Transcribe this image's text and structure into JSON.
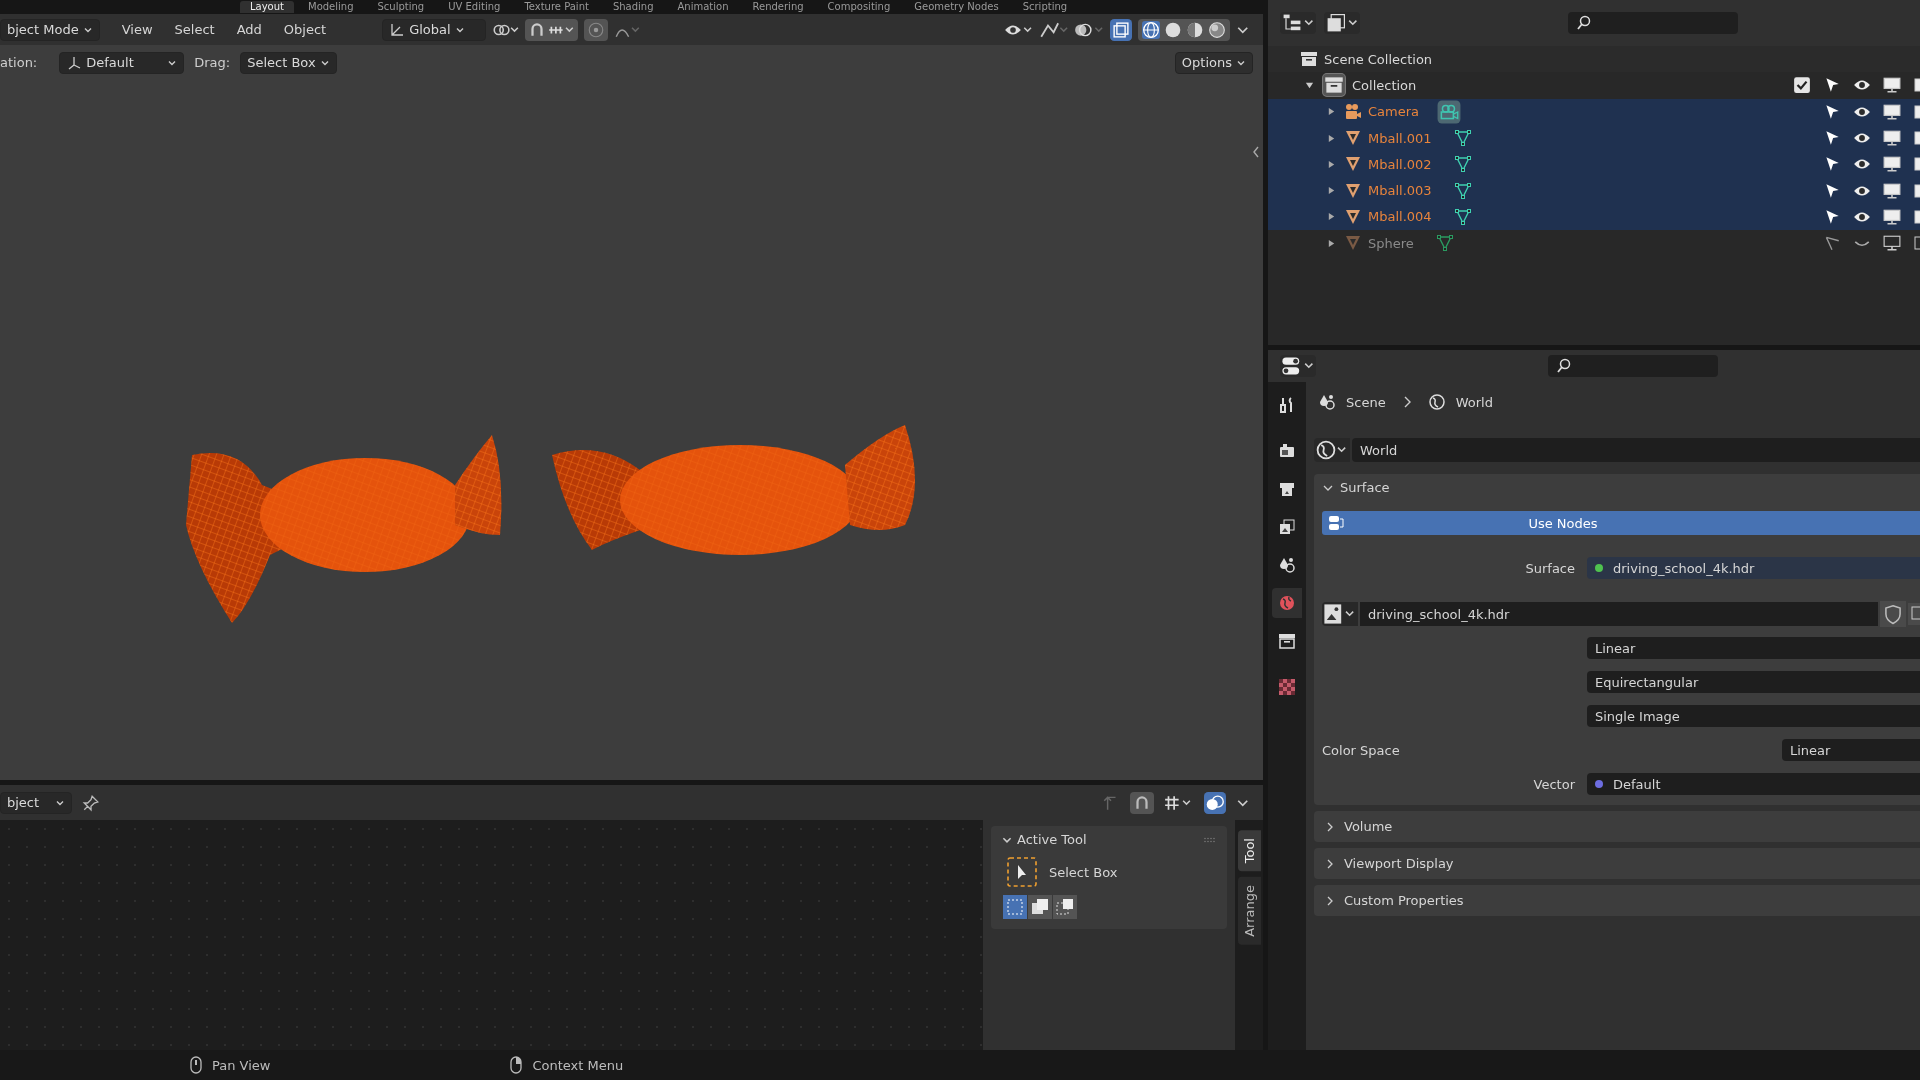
{
  "workspace_tabs": [
    {
      "label": "Layout",
      "selected": true
    },
    {
      "label": "Modeling",
      "selected": false
    },
    {
      "label": "Sculpting",
      "selected": false
    },
    {
      "label": "UV Editing",
      "selected": false
    },
    {
      "label": "Texture Paint",
      "selected": false
    },
    {
      "label": "Shading",
      "selected": false
    },
    {
      "label": "Animation",
      "selected": false
    },
    {
      "label": "Rendering",
      "selected": false
    },
    {
      "label": "Compositing",
      "selected": false
    },
    {
      "label": "Geometry Nodes",
      "selected": false
    },
    {
      "label": "Scripting",
      "selected": false
    }
  ],
  "viewport_header": {
    "mode": "bject Mode",
    "menus": [
      "View",
      "Select",
      "Add",
      "Object"
    ],
    "orientation": "Global"
  },
  "tool_settings": {
    "orientation_label": "ation:",
    "orientation": "Default",
    "drag_label": "Drag:",
    "drag": "Select Box",
    "options": "Options"
  },
  "outliner": {
    "items": [
      {
        "name": "Scene Collection",
        "kind": "scene_collection",
        "selected": false,
        "children": [
          {
            "name": "Collection",
            "kind": "collection",
            "selected": false,
            "expanded": true,
            "checked": true,
            "children": [
              {
                "name": "Camera",
                "kind": "camera",
                "selected": true,
                "expanded": false,
                "visible": true
              },
              {
                "name": "Mball.001",
                "kind": "mesh",
                "selected": true,
                "expanded": false,
                "visible": true
              },
              {
                "name": "Mball.002",
                "kind": "mesh",
                "selected": true,
                "expanded": false,
                "visible": true
              },
              {
                "name": "Mball.003",
                "kind": "mesh",
                "selected": true,
                "expanded": false,
                "visible": true
              },
              {
                "name": "Mball.004",
                "kind": "mesh",
                "selected": true,
                "expanded": false,
                "visible": true
              },
              {
                "name": "Sphere",
                "kind": "mesh",
                "selected": false,
                "expanded": false,
                "visible": false
              }
            ]
          }
        ]
      }
    ]
  },
  "properties": {
    "tabs": [
      {
        "kind": "tool",
        "selected": false
      },
      {
        "kind": "render",
        "selected": false
      },
      {
        "kind": "output",
        "selected": false
      },
      {
        "kind": "view_layer",
        "selected": false
      },
      {
        "kind": "scene",
        "selected": false
      },
      {
        "kind": "world",
        "selected": true
      },
      {
        "kind": "collection",
        "selected": false
      },
      {
        "kind": "texture",
        "selected": false
      }
    ],
    "breadcrumb": [
      "Scene",
      "World"
    ],
    "world_name": "World",
    "surface_panel": {
      "title": "Surface",
      "expanded": true,
      "use_nodes": "Use Nodes",
      "surface_label": "Surface",
      "surface_value": "driving_school_4k.hdr",
      "image_name": "driving_school_4k.hdr",
      "options": [
        "Linear",
        "Equirectangular",
        "Single Image"
      ],
      "color_space_label": "Color Space",
      "color_space": "Linear",
      "vector_label": "Vector",
      "vector_value": "Default"
    },
    "panels": [
      {
        "title": "Volume",
        "expanded": false
      },
      {
        "title": "Viewport Display",
        "expanded": false
      },
      {
        "title": "Custom Properties",
        "expanded": false
      }
    ]
  },
  "bottom_editor": {
    "mode": "bject",
    "active_tool": {
      "title": "Active Tool",
      "tool": "Select Box"
    },
    "select_modes": [
      {
        "kind": "set",
        "selected": true
      },
      {
        "kind": "extend",
        "selected": false
      },
      {
        "kind": "subtract",
        "selected": false
      }
    ],
    "side_tabs": [
      {
        "label": "Tool",
        "selected": true
      },
      {
        "label": "Arrange",
        "selected": false
      }
    ]
  },
  "status_bar": [
    "Pan View",
    "Context Menu"
  ]
}
